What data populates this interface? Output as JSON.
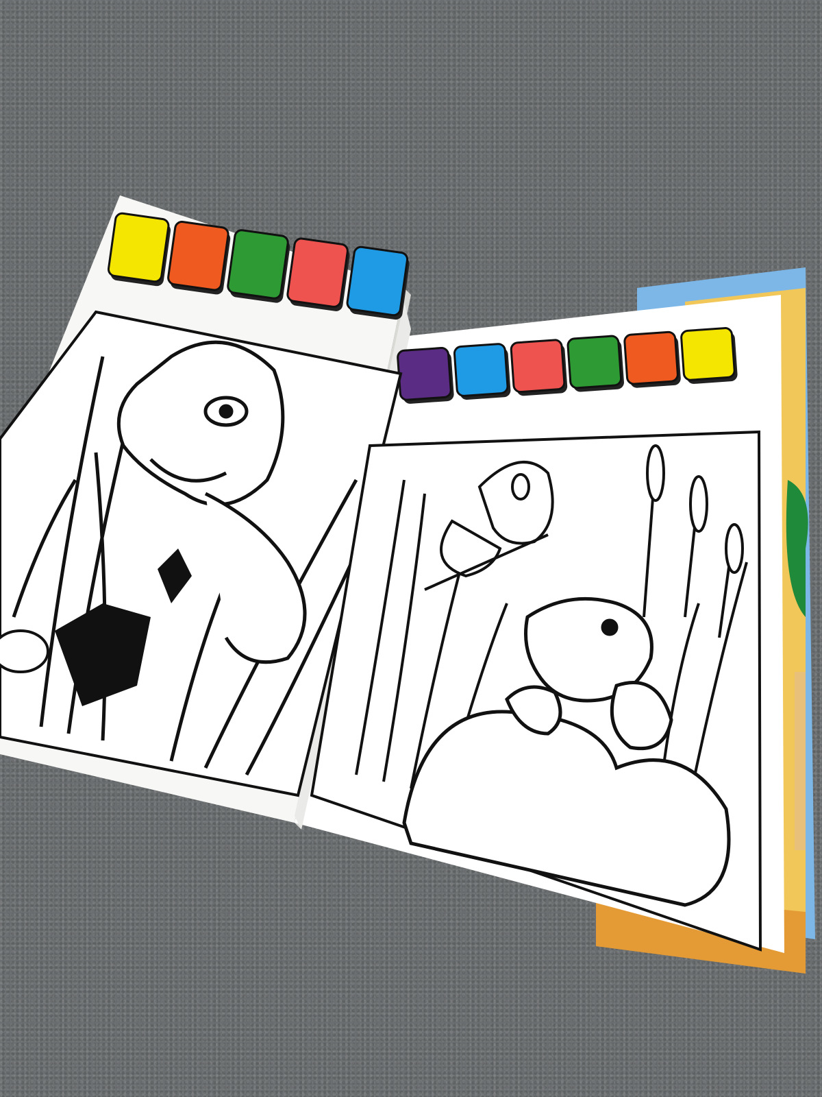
{
  "scene": {
    "description_free": true,
    "background_color": "#6b6e70",
    "page_color": "#f7f7f5",
    "left_palette": [
      "#f4e600",
      "#ee5a1f",
      "#2e9a34",
      "#ef5350",
      "#1f9be6",
      "#5b2c83"
    ],
    "right_palette": [
      "#5b2c83",
      "#1f9be6",
      "#ef5350",
      "#2e9a34",
      "#ee5a1f",
      "#f4e600"
    ],
    "cover_color": "#f2c75a",
    "cover_accent": "#7cb7e8",
    "icons": {
      "left_illustration": "dinosaur-in-grass-icon",
      "right_illustration": "dinosaur-with-butterfly-icon"
    }
  }
}
